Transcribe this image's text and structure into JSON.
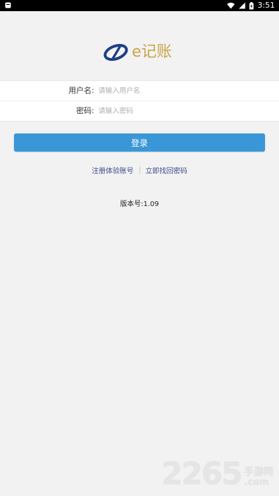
{
  "status_bar": {
    "time": "3:51",
    "icons": [
      "notification-icon",
      "wifi-icon",
      "signal-icon",
      "battery-icon"
    ]
  },
  "logo": {
    "text": "e记账",
    "icon": "logo-icon",
    "brand_color": "#c9a44a",
    "mark_color": "#1f3f8a"
  },
  "form": {
    "username": {
      "label": "用户名:",
      "placeholder": "请输入用户名",
      "value": ""
    },
    "password": {
      "label": "密码:",
      "placeholder": "请输入密码",
      "value": ""
    }
  },
  "login_button": {
    "label": "登录",
    "color": "#3a97d7"
  },
  "links": {
    "register": "注册体验账号",
    "recover": "立即找回密码",
    "color": "#3d4c8c"
  },
  "version": "版本号:1.09",
  "watermark": {
    "number": "2265",
    "cn": "手游网",
    "suffix": ".com"
  }
}
